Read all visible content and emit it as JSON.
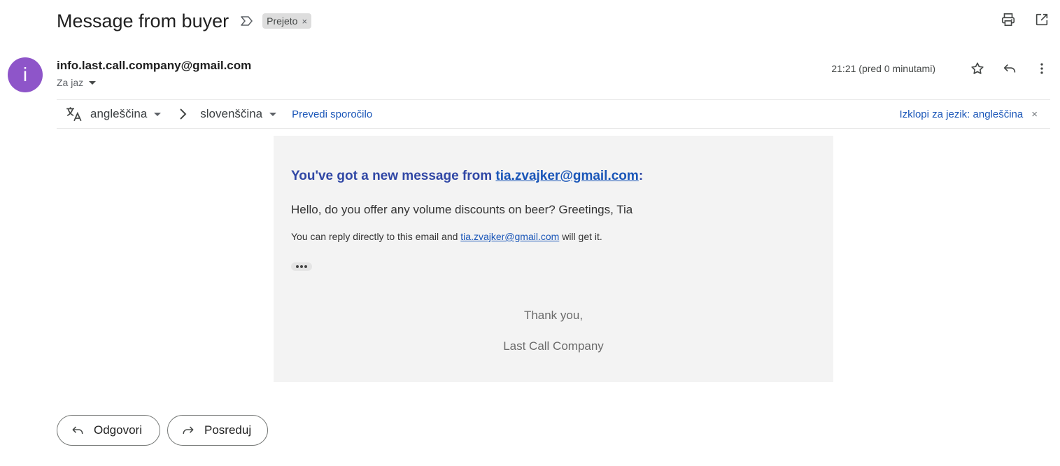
{
  "subject": {
    "title": "Message from buyer",
    "label": "Prejeto",
    "label_close": "×"
  },
  "header": {
    "avatar_letter": "i",
    "avatar_color": "#8e55c9",
    "sender_email": "info.last.call.company@gmail.com",
    "recipient": "Za jaz",
    "time": "21:21 (pred 0 minutami)",
    "icons": [
      "print-icon",
      "open-in-new-window-icon",
      "star-icon",
      "reply-icon",
      "more-vert-icon"
    ]
  },
  "translate_bar": {
    "source_lang": "angleščina",
    "target_lang": "slovenščina",
    "translate_link": "Prevedi sporočilo",
    "turn_off": "Izklopi za jezik: angleščina",
    "close": "×"
  },
  "email": {
    "headline_prefix": "You've got a new message from ",
    "headline_email": "tia.zvajker@gmail.com",
    "headline_suffix": ":",
    "message": "Hello, do you offer any volume discounts on beer? Greetings, Tia",
    "reply_prefix": "You can reply directly to this email and ",
    "reply_email": "tia.zvajker@gmail.com",
    "reply_suffix": " will get it.",
    "thanks": "Thank you,",
    "company": "Last Call Company",
    "body_bg": "#f3f3f3",
    "headline_color": "#3047a5",
    "link_color": "#1a56b8"
  },
  "actions": {
    "reply": "Odgovori",
    "forward": "Posreduj"
  }
}
